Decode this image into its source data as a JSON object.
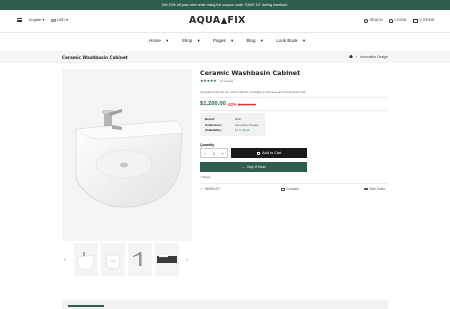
{
  "promo": {
    "text": "Get 10% off your next order using the coupon code \"SAVE 10\" during checkout."
  },
  "header": {
    "language": "English",
    "currency": "USD",
    "logo": {
      "left": "AQUA",
      "right": "FIX"
    },
    "search_label": "SEACH",
    "login_label": "LOGIN",
    "cart_label": "0 ITEMS"
  },
  "nav": {
    "items": [
      "Home",
      "Shop",
      "Pages",
      "Blog",
      "Look Book"
    ]
  },
  "breadcrumb": {
    "title": "Ceramic Washbasin Cabinet",
    "current": "Innovative Design"
  },
  "product": {
    "title": "Ceramic Washbasin Cabinet",
    "rating": 5,
    "stars": "★★★★★",
    "reviews": "(1 review)",
    "description": "Integrated into the ton of the cabinet, providing a cohesive and streamlined look",
    "price": "$1,200.00",
    "discount": "-62%",
    "old_price": "$3,500.00",
    "info": {
      "brand": {
        "key": "Brand :",
        "value": "Rath"
      },
      "collections": {
        "key": "Collections :",
        "value": "Innovative Design"
      },
      "availability": {
        "key": "Availability :",
        "value": "11 In Stock"
      }
    },
    "quantity_label": "Quantity",
    "quantity_value": "1",
    "qty_minus": "−",
    "qty_plus": "+",
    "add_to_cart": "Add to Cart",
    "buy_now": "Buy It Now",
    "share": "Share",
    "wishlist": "WISHLIST",
    "compare": "Compare",
    "size_guide": "Size Guide"
  },
  "gallery": {
    "prev": "‹",
    "next": "›"
  },
  "colors": {
    "accent": "#2f5e4e",
    "sale": "#dd3333",
    "in_stock": "#2e8b57"
  }
}
